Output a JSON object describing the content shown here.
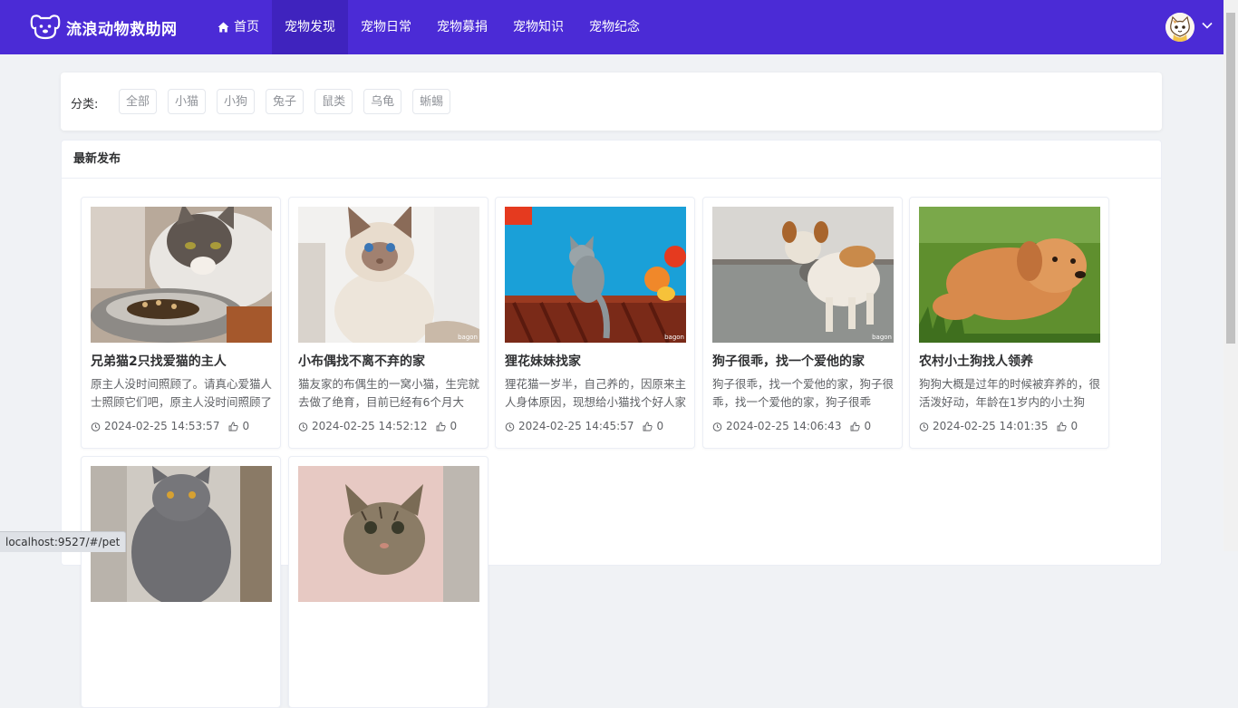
{
  "header": {
    "brand": "流浪动物救助网",
    "nav": [
      {
        "label": "首页",
        "icon": "home-icon"
      },
      {
        "label": "宠物发现",
        "active": true
      },
      {
        "label": "宠物日常"
      },
      {
        "label": "宠物募捐"
      },
      {
        "label": "宠物知识"
      },
      {
        "label": "宠物纪念"
      }
    ],
    "colors": {
      "bar": "#4b2bd6",
      "active": "#3f23be"
    }
  },
  "filter": {
    "label": "分类:",
    "tags": [
      "全部",
      "小猫",
      "小狗",
      "兔子",
      "鼠类",
      "乌龟",
      "蜥蜴"
    ]
  },
  "list": {
    "title": "最新发布",
    "pets": [
      {
        "title": "兄弟猫2只找爱猫的主人",
        "desc": "原主人没时间照顾了。请真心爱猫人士照顾它们吧，原主人没时间照顾了",
        "time": "2024-02-25 14:53:57",
        "likes": "0",
        "image": "cat-eating-photo"
      },
      {
        "title": "小布偶找不离不弃的家",
        "desc": "猫友家的布偶生的一窝小猫，生完就去做了绝育，目前已经有6个月大",
        "time": "2024-02-25 14:52:12",
        "likes": "0",
        "image": "ragdoll-kitten-photo",
        "watermark": "bagon"
      },
      {
        "title": "狸花妹妹找家",
        "desc": "狸花猫一岁半，自己养的，因原来主人身体原因，现想给小猫找个好人家",
        "time": "2024-02-25 14:45:57",
        "likes": "0",
        "image": "tabby-cat-photo",
        "watermark": "bagon"
      },
      {
        "title": "狗子很乖，找一个爱他的家",
        "desc": "狗子很乖，找一个爱他的家，狗子很乖，找一个爱他的家，狗子很乖",
        "time": "2024-02-25 14:06:43",
        "likes": "0",
        "image": "small-dog-photo",
        "watermark": "bagon"
      },
      {
        "title": "农村小土狗找人领养",
        "desc": "狗狗大概是过年的时候被弃养的，很活泼好动，年龄在1岁内的小土狗",
        "time": "2024-02-25 14:01:35",
        "likes": "0",
        "image": "puppy-grass-photo"
      },
      {
        "title": "",
        "desc": "",
        "time": "",
        "likes": "",
        "image": "grey-cat-photo"
      },
      {
        "title": "",
        "desc": "",
        "time": "",
        "likes": "",
        "image": "tabby-kitten-photo"
      }
    ]
  },
  "status_url": "localhost:9527/#/pet"
}
